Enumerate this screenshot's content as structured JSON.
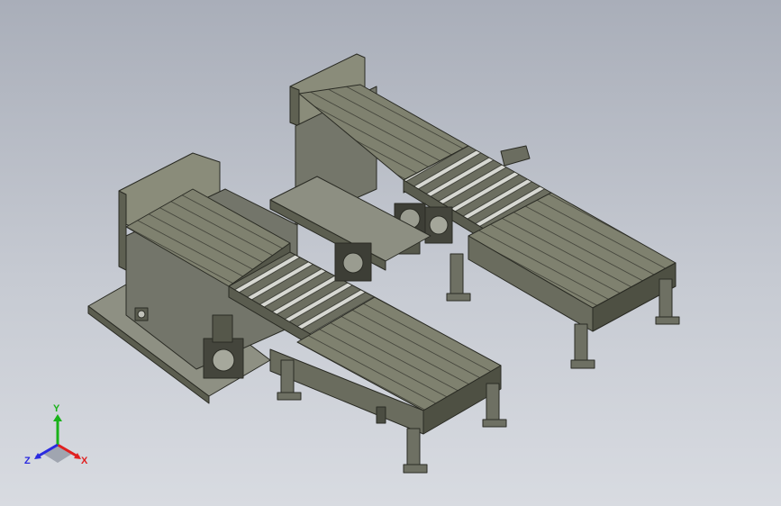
{
  "viewport": {
    "background_top": "#a9aeb9",
    "background_bottom": "#d8dbe1",
    "model_color": "#7b7d6c",
    "model_edge_color": "#2a2b24"
  },
  "triad": {
    "x_label": "X",
    "y_label": "Y",
    "z_label": "Z",
    "x_color": "#e02020",
    "y_color": "#19b219",
    "z_color": "#2a2ae0"
  },
  "model": {
    "assemblies": [
      {
        "name": "rear-conveyor-line",
        "components": [
          "side-guard-panel",
          "flat-deck",
          "roller-section",
          "drive-motors",
          "support-legs"
        ]
      },
      {
        "name": "front-conveyor-line",
        "components": [
          "side-guard-panel",
          "flat-deck",
          "roller-section",
          "drive-motors",
          "base-plate",
          "support-legs"
        ]
      }
    ]
  }
}
